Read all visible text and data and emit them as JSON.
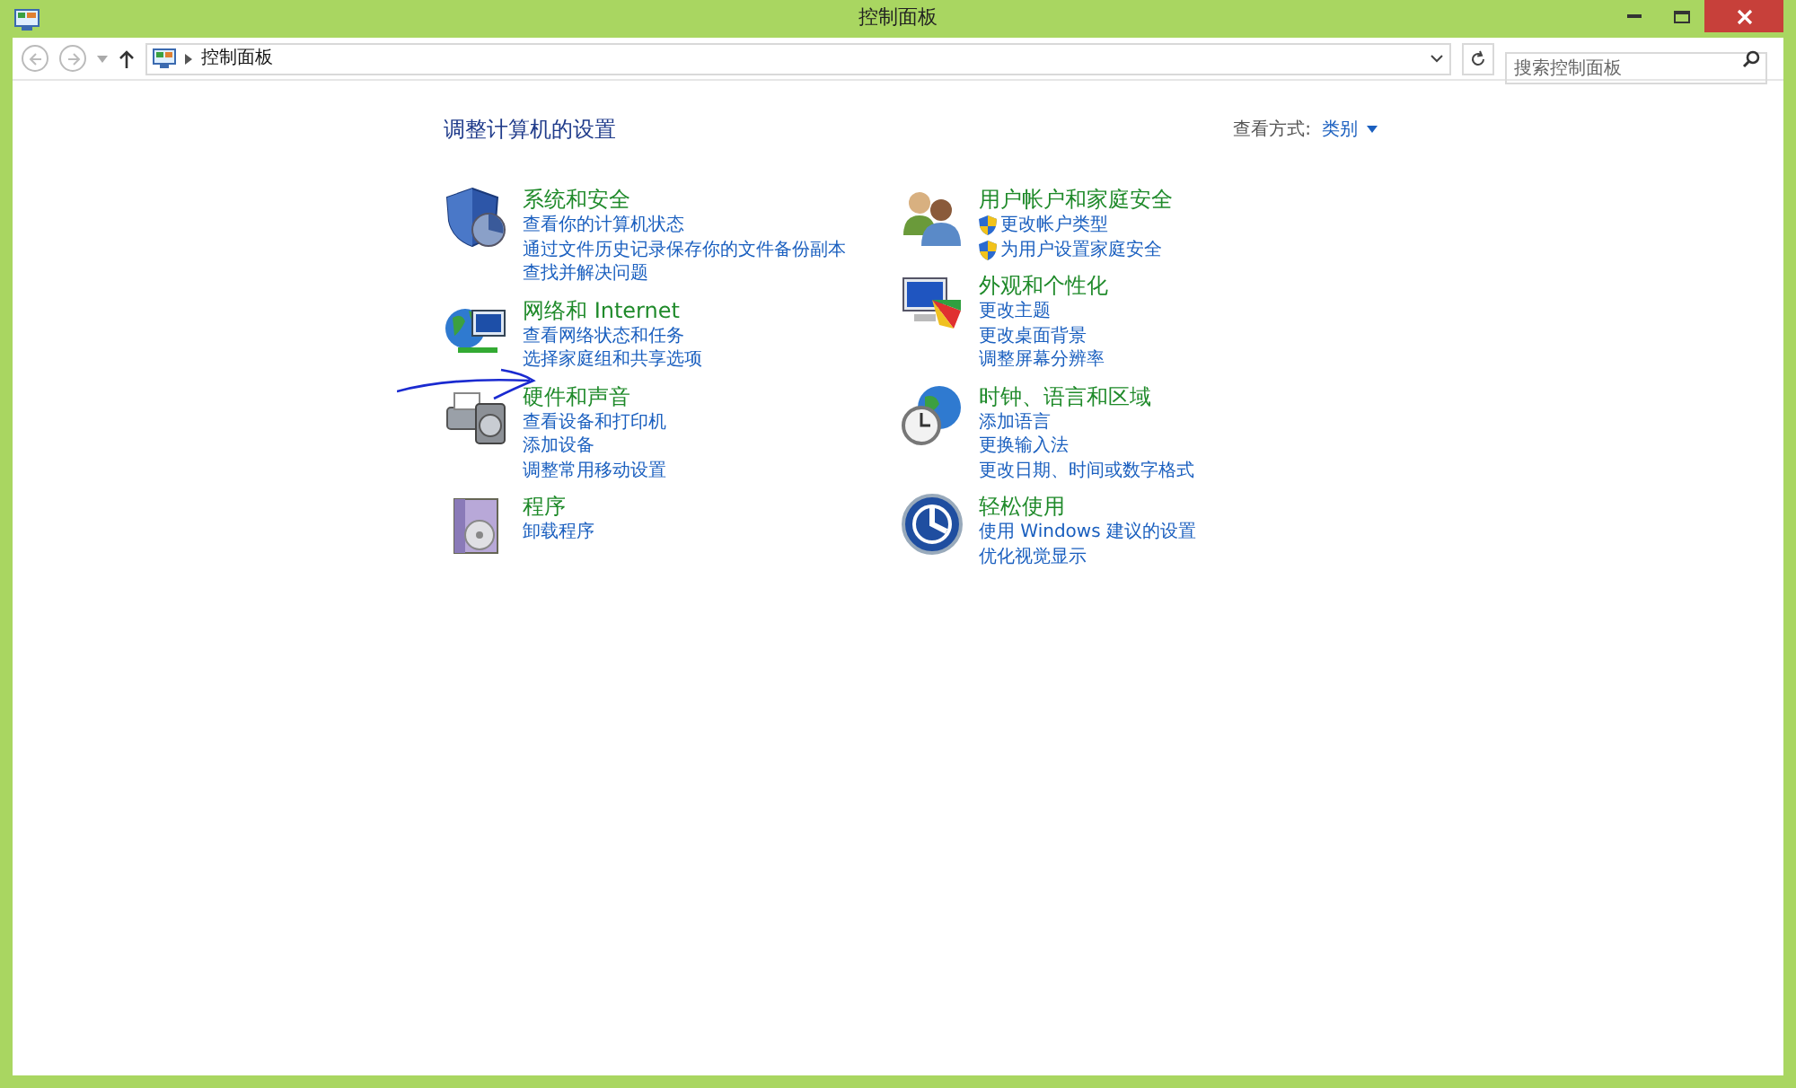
{
  "window": {
    "title": "控制面板"
  },
  "address_bar": {
    "path": "控制面板"
  },
  "search": {
    "placeholder": "搜索控制面板"
  },
  "heading": "调整计算机的设置",
  "view_by": {
    "label": "查看方式:",
    "value": "类别"
  },
  "columns": [
    [
      {
        "kind": "security",
        "title": "系统和安全",
        "links": [
          {
            "text": "查看你的计算机状态",
            "shield": false
          },
          {
            "text": "通过文件历史记录保存你的文件备份副本",
            "shield": false
          },
          {
            "text": "查找并解决问题",
            "shield": false
          }
        ]
      },
      {
        "kind": "network",
        "title": "网络和 Internet",
        "links": [
          {
            "text": "查看网络状态和任务",
            "shield": false
          },
          {
            "text": "选择家庭组和共享选项",
            "shield": false
          }
        ]
      },
      {
        "kind": "hardware",
        "title": "硬件和声音",
        "links": [
          {
            "text": "查看设备和打印机",
            "shield": false
          },
          {
            "text": "添加设备",
            "shield": false
          },
          {
            "text": "调整常用移动设置",
            "shield": false
          }
        ]
      },
      {
        "kind": "programs",
        "title": "程序",
        "links": [
          {
            "text": "卸载程序",
            "shield": false
          }
        ]
      }
    ],
    [
      {
        "kind": "users",
        "title": "用户帐户和家庭安全",
        "links": [
          {
            "text": "更改帐户类型",
            "shield": true
          },
          {
            "text": "为用户设置家庭安全",
            "shield": true
          }
        ]
      },
      {
        "kind": "appearance",
        "title": "外观和个性化",
        "links": [
          {
            "text": "更改主题",
            "shield": false
          },
          {
            "text": "更改桌面背景",
            "shield": false
          },
          {
            "text": "调整屏幕分辨率",
            "shield": false
          }
        ]
      },
      {
        "kind": "clock",
        "title": "时钟、语言和区域",
        "links": [
          {
            "text": "添加语言",
            "shield": false
          },
          {
            "text": "更换输入法",
            "shield": false
          },
          {
            "text": "更改日期、时间或数字格式",
            "shield": false
          }
        ]
      },
      {
        "kind": "access",
        "title": "轻松使用",
        "links": [
          {
            "text": "使用 Windows 建议的设置",
            "shield": false
          },
          {
            "text": "优化视觉显示",
            "shield": false
          }
        ]
      }
    ]
  ]
}
